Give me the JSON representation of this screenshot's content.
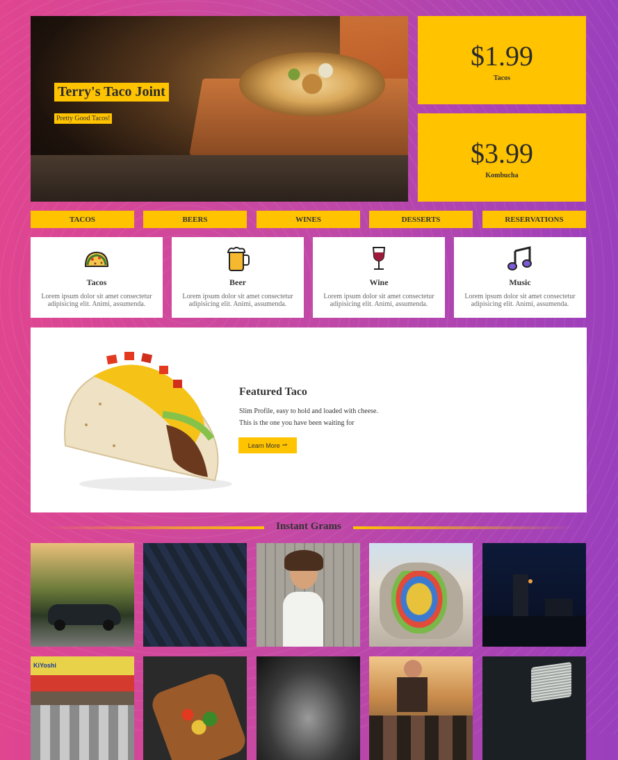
{
  "hero": {
    "title": "Terry's Taco Joint",
    "subtitle": "Pretty Good Tacos!"
  },
  "prices": [
    {
      "amount": "$1.99",
      "label": "Tacos"
    },
    {
      "amount": "$3.99",
      "label": "Kombucha"
    }
  ],
  "nav": [
    "TACOS",
    "BEERS",
    "WINES",
    "DESSERTS",
    "RESERVATIONS"
  ],
  "cards": [
    {
      "icon": "taco-icon",
      "title": "Tacos",
      "desc": "Lorem ipsum dolor sit amet consectetur adipisicing elit. Animi, assumenda."
    },
    {
      "icon": "beer-icon",
      "title": "Beer",
      "desc": "Lorem ipsum dolor sit amet consectetur adipisicing elit. Animi, assumenda."
    },
    {
      "icon": "wine-glass-icon",
      "title": "Wine",
      "desc": "Lorem ipsum dolor sit amet consectetur adipisicing elit. Animi, assumenda."
    },
    {
      "icon": "music-note-icon",
      "title": "Music",
      "desc": "Lorem ipsum dolor sit amet consectetur adipisicing elit. Animi, assumenda."
    }
  ],
  "featured": {
    "heading": "Featured Taco",
    "line1": "Slim Profile, easy to hold and loaded with cheese.",
    "line2": "This is the one you have been waiting for",
    "button": "Learn More"
  },
  "grams": {
    "title": "Instant Grams"
  },
  "colors": {
    "accent": "#ffc300",
    "bg_start": "#e0458f",
    "bg_end": "#9a3fbd"
  }
}
